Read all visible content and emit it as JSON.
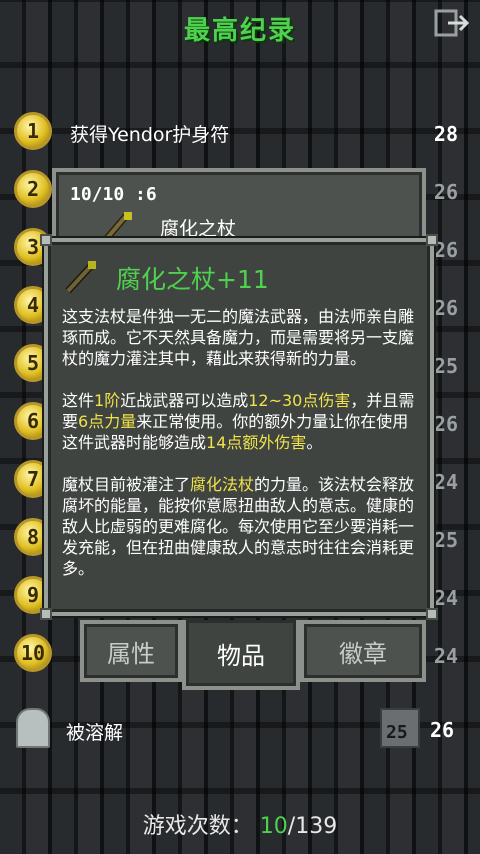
{
  "header": {
    "title": "最高纪录"
  },
  "records": [
    {
      "rank": "1",
      "text": "获得Yendor护身符",
      "score": "28",
      "dim": false
    },
    {
      "rank": "2",
      "text": "",
      "score": "26",
      "dim": true
    },
    {
      "rank": "3",
      "text": "",
      "score": "26",
      "dim": true
    },
    {
      "rank": "4",
      "text": "",
      "score": "26",
      "dim": true
    },
    {
      "rank": "5",
      "text": "",
      "score": "25",
      "dim": true
    },
    {
      "rank": "6",
      "text": "",
      "score": "26",
      "dim": true
    },
    {
      "rank": "7",
      "text": "",
      "score": "24",
      "dim": true
    },
    {
      "rank": "8",
      "text": "",
      "score": "25",
      "dim": true
    },
    {
      "rank": "9",
      "text": "",
      "score": "24",
      "dim": true
    },
    {
      "rank": "10",
      "text": "",
      "score": "24",
      "dim": true
    }
  ],
  "dissolved": {
    "label": "被溶解",
    "level": "25",
    "score": "26"
  },
  "games": {
    "label": "游戏次数：",
    "current": "10",
    "total": "/139"
  },
  "slot": {
    "header": "10/10 :6",
    "name": "腐化之杖"
  },
  "info": {
    "title": "腐化之杖+11",
    "p1": "这支法杖是件独一无二的魔法武器，由法师亲自雕琢而成。它不天然具备魔力，而是需要将另一支魔杖的魔力灌注其中，藉此来获得新的力量。",
    "p2_a": "这件",
    "p2_b": "1阶",
    "p2_c": "近战武器可以造成",
    "p2_d": "12~30点伤害",
    "p2_e": "，并且需要",
    "p2_f": "6点力量",
    "p2_g": "来正常使用。你的额外力量让你在使用这件武器时能够造成",
    "p2_h": "14点额外伤害",
    "p2_i": "。",
    "p3_a": "魔杖目前被灌注了",
    "p3_b": "腐化法杖",
    "p3_c": "的力量。该法杖会释放腐坏的能量，能按你意愿扭曲敌人的意志。健康的敌人比虚弱的更难腐化。每次使用它至少要消耗一发充能，但在扭曲健康敌人的意志时往往会消耗更多。"
  },
  "tabs": {
    "stats": "属性",
    "items": "物品",
    "badges": "徽章"
  },
  "colors": {
    "accent": "#4fd14f",
    "highlight": "#f0e24a"
  }
}
